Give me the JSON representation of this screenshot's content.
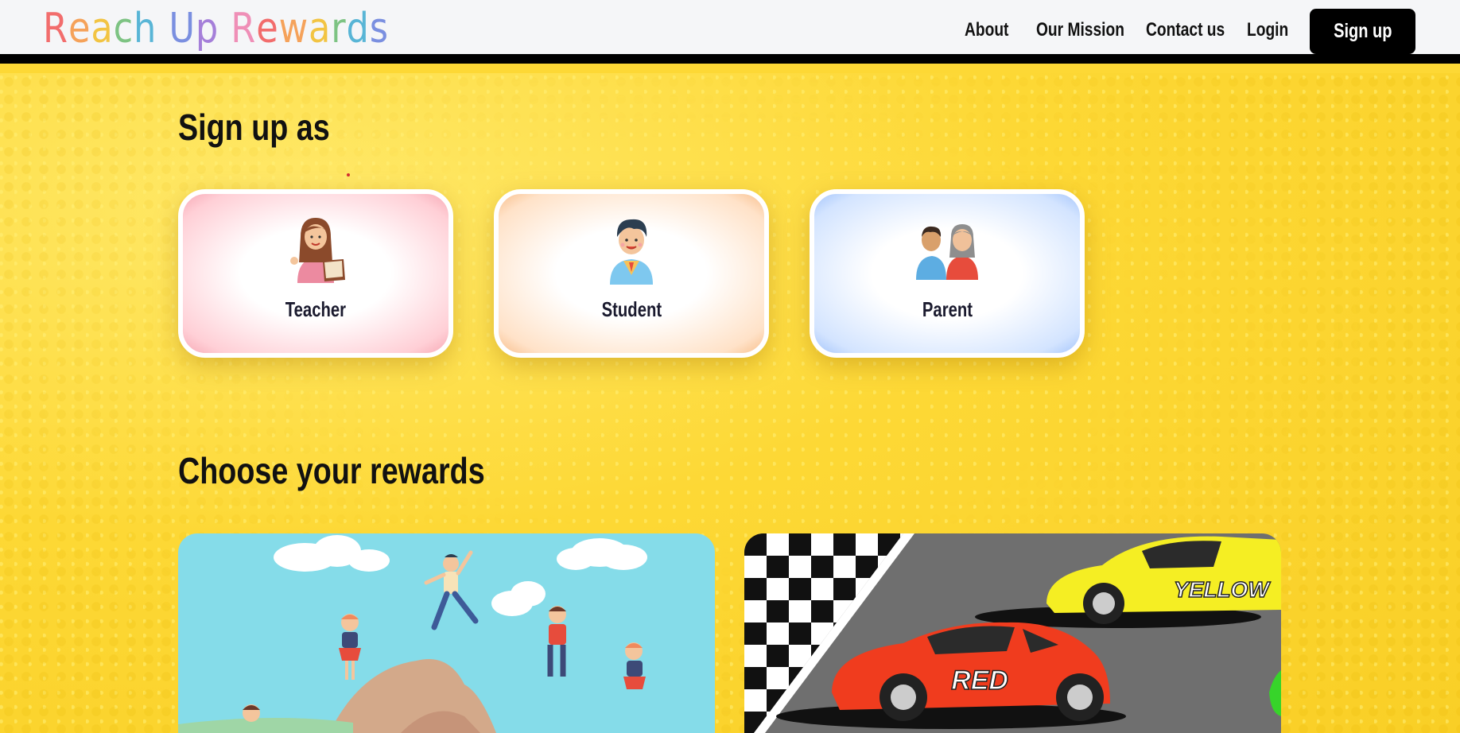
{
  "header": {
    "logo_letters": [
      {
        "ch": "R",
        "color": "#f26d6d"
      },
      {
        "ch": "e",
        "color": "#f5a25a"
      },
      {
        "ch": "a",
        "color": "#f2c443"
      },
      {
        "ch": "c",
        "color": "#7dc383"
      },
      {
        "ch": "h",
        "color": "#58b5d6"
      },
      {
        "ch": " ",
        "color": "#000000"
      },
      {
        "ch": "U",
        "color": "#7a8fe0"
      },
      {
        "ch": "p",
        "color": "#a57fd9"
      },
      {
        "ch": " ",
        "color": "#000000"
      },
      {
        "ch": "R",
        "color": "#ef8fb7"
      },
      {
        "ch": "e",
        "color": "#f26d6d"
      },
      {
        "ch": "w",
        "color": "#f5a25a"
      },
      {
        "ch": "a",
        "color": "#f2c443"
      },
      {
        "ch": "r",
        "color": "#7dc383"
      },
      {
        "ch": "d",
        "color": "#58b5d6"
      },
      {
        "ch": "s",
        "color": "#7a8fe0"
      }
    ],
    "nav": {
      "about": "About",
      "mission": "Our Mission",
      "contact": "Contact us",
      "login": "Login",
      "signup": "Sign up"
    }
  },
  "signup_section": {
    "title": "Sign up as",
    "roles": [
      {
        "label": "Teacher",
        "icon": "teacher-icon"
      },
      {
        "label": "Student",
        "icon": "student-icon"
      },
      {
        "label": "Parent",
        "icon": "parents-icon"
      }
    ]
  },
  "rewards_section": {
    "title": "Choose your rewards",
    "cards": [
      {
        "icon": "kids-on-mountain-illustration"
      },
      {
        "icon": "race-cars-illustration",
        "car_labels": [
          "YELLOW",
          "RED"
        ]
      }
    ]
  },
  "colors": {
    "background": "#fdd835",
    "header_bg": "#f5f6f8",
    "signup_button": "#000000"
  }
}
